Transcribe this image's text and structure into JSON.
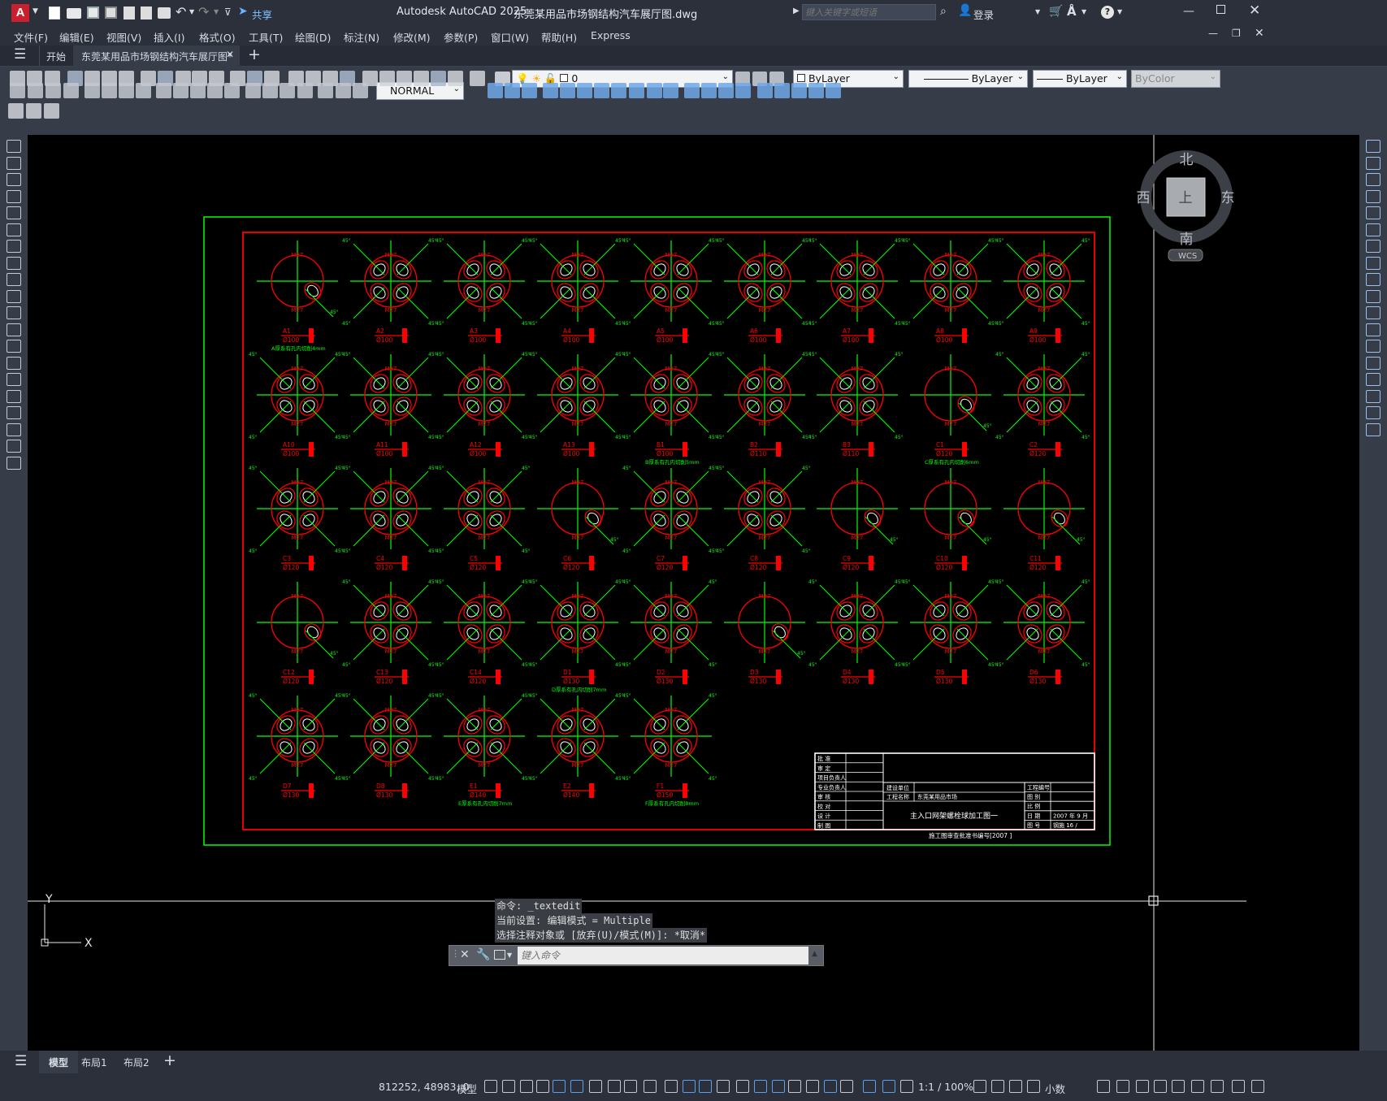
{
  "app": {
    "title": "Autodesk AutoCAD 2025",
    "filename": "东莞某用品市场钢结构汽车展厅图.dwg",
    "search_placeholder": "键入关键字或短语",
    "login_label": "登录",
    "share_label": "共享"
  },
  "menu": [
    "文件(F)",
    "编辑(E)",
    "视图(V)",
    "插入(I)",
    "格式(O)",
    "工具(T)",
    "绘图(D)",
    "标注(N)",
    "修改(M)",
    "参数(P)",
    "窗口(W)",
    "帮助(H)",
    "Express"
  ],
  "tabs": {
    "start": "开始",
    "doc": "东莞某用品市场钢结构汽车展厅图*"
  },
  "toolbar": {
    "layer_value": "0",
    "color": "ByLayer",
    "linetype": "ByLayer",
    "lineweight": "ByLayer",
    "plotstyle": "ByColor",
    "dimstyle": "NORMAL"
  },
  "viewcube": {
    "north": "北",
    "south": "南",
    "east": "东",
    "west": "西",
    "top": "上",
    "wcs": "WCS"
  },
  "ucs": {
    "x": "X",
    "y": "Y"
  },
  "drawing": {
    "labels": [
      {
        "a": "A1",
        "b": "Ø100"
      },
      {
        "a": "A2",
        "b": "Ø100"
      },
      {
        "a": "A3",
        "b": "Ø100"
      },
      {
        "a": "A4",
        "b": "Ø100"
      },
      {
        "a": "A5",
        "b": "Ø100"
      },
      {
        "a": "A6",
        "b": "Ø100"
      },
      {
        "a": "A7",
        "b": "Ø100"
      },
      {
        "a": "A8",
        "b": "Ø100"
      },
      {
        "a": "A9",
        "b": "Ø100"
      },
      {
        "a": "A10",
        "b": "Ø100"
      },
      {
        "a": "A11",
        "b": "Ø100"
      },
      {
        "a": "A12",
        "b": "Ø100"
      },
      {
        "a": "A13",
        "b": "Ø100"
      },
      {
        "a": "B1",
        "b": "Ø100"
      },
      {
        "a": "B2",
        "b": "Ø110"
      },
      {
        "a": "B3",
        "b": "Ø110"
      },
      {
        "a": "C1",
        "b": "Ø120"
      },
      {
        "a": "C2",
        "b": "Ø120"
      },
      {
        "a": "C3",
        "b": "Ø120"
      },
      {
        "a": "C4",
        "b": "Ø120"
      },
      {
        "a": "C5",
        "b": "Ø120"
      },
      {
        "a": "C6",
        "b": "Ø120"
      },
      {
        "a": "C7",
        "b": "Ø120"
      },
      {
        "a": "C8",
        "b": "Ø120"
      },
      {
        "a": "C9",
        "b": "Ø120"
      },
      {
        "a": "C10",
        "b": "Ø120"
      },
      {
        "a": "C11",
        "b": "Ø120"
      },
      {
        "a": "C12",
        "b": "Ø120"
      },
      {
        "a": "C13",
        "b": "Ø120"
      },
      {
        "a": "C14",
        "b": "Ø120"
      },
      {
        "a": "D1",
        "b": "Ø130"
      },
      {
        "a": "D2",
        "b": "Ø130"
      },
      {
        "a": "D3",
        "b": "Ø130"
      },
      {
        "a": "D4",
        "b": "Ø130"
      },
      {
        "a": "D5",
        "b": "Ø130"
      },
      {
        "a": "D6",
        "b": "Ø130"
      },
      {
        "a": "D7",
        "b": "Ø130"
      },
      {
        "a": "D8",
        "b": "Ø130"
      },
      {
        "a": "E1",
        "b": "Ø140"
      },
      {
        "a": "E2",
        "b": "Ø140"
      },
      {
        "a": "F1",
        "b": "Ø150"
      }
    ],
    "notes": [
      {
        "idx": 0,
        "text": "A厚系有孔内切削4mm"
      },
      {
        "idx": 13,
        "text": "B厚系有孔内切削5mm"
      },
      {
        "idx": 16,
        "text": "C厚系有孔内切削6mm"
      },
      {
        "idx": 30,
        "text": "D厚系有孔内切削7mm"
      },
      {
        "idx": 38,
        "text": "E厚系有孔内切削7mm"
      },
      {
        "idx": 40,
        "text": "F厚系有孔内切削8mm"
      }
    ],
    "single_hole_idx": [
      0,
      16,
      21,
      24,
      25,
      26,
      27,
      32
    ],
    "title_block": {
      "rows_left": [
        "批 准",
        "审 定",
        "项目负责人",
        "专业负责人",
        "审 核",
        "校 对",
        "设 计",
        "制 图"
      ],
      "client_label": "建设单位",
      "project_label": "工程名称",
      "project_value": "东莞某用品市场",
      "drawing_title": "主入口网架螺栓球加工图一",
      "right_labels": [
        "工程编号",
        "图 别",
        "比 例",
        "日 期",
        "图 号"
      ],
      "date_value": "2007 年 9 月",
      "sheet_value": "钢施 16 /",
      "footer": "施工图审查批准书编号[2007  ]"
    }
  },
  "command": {
    "history": [
      "命令: _textedit",
      "当前设置: 编辑模式 = Multiple",
      "选择注释对象或 [放弃(U)/模式(M)]: *取消*"
    ],
    "placeholder": "键入命令"
  },
  "layout_tabs": [
    "模型",
    "布局1",
    "布局2"
  ],
  "status": {
    "coords": "812252, 48983, 0",
    "model": "模型",
    "scale": "1:1 / 100%",
    "units": "小数"
  },
  "colors": {
    "bg": "#000000",
    "ui": "#2b303b",
    "green": "#00ff00",
    "red": "#ff0000",
    "white": "#ffffff"
  }
}
